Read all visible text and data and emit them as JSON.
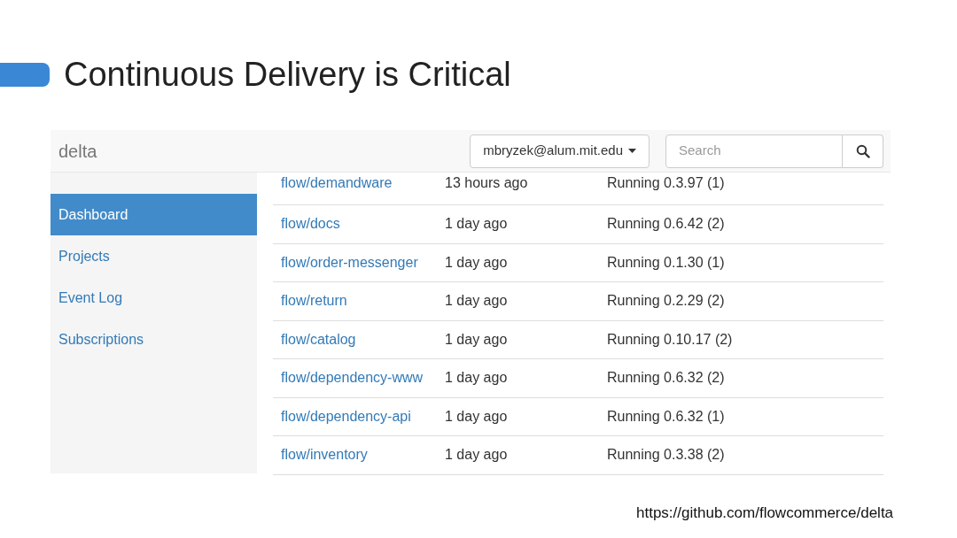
{
  "slide": {
    "title": "Continuous Delivery is Critical",
    "footer_url": "https://github.com/flowcommerce/delta"
  },
  "navbar": {
    "brand": "delta",
    "user_menu": "mbryzek@alum.mit.edu",
    "search": {
      "placeholder": "Search"
    }
  },
  "sidebar": {
    "items": [
      {
        "label": "Dashboard",
        "selected": true
      },
      {
        "label": "Projects",
        "selected": false
      },
      {
        "label": "Event Log",
        "selected": false
      },
      {
        "label": "Subscriptions",
        "selected": false
      }
    ]
  },
  "table": {
    "rows": [
      {
        "project": "flow/demandware",
        "time": "13 hours ago",
        "status": "Running 0.3.97 (1)"
      },
      {
        "project": "flow/docs",
        "time": "1 day ago",
        "status": "Running 0.6.42 (2)"
      },
      {
        "project": "flow/order-messenger",
        "time": "1 day ago",
        "status": "Running 0.1.30 (1)"
      },
      {
        "project": "flow/return",
        "time": "1 day ago",
        "status": "Running 0.2.29 (2)"
      },
      {
        "project": "flow/catalog",
        "time": "1 day ago",
        "status": "Running 0.10.17 (2)"
      },
      {
        "project": "flow/dependency-www",
        "time": "1 day ago",
        "status": "Running 0.6.32 (2)"
      },
      {
        "project": "flow/dependency-api",
        "time": "1 day ago",
        "status": "Running 0.6.32 (1)"
      },
      {
        "project": "flow/inventory",
        "time": "1 day ago",
        "status": "Running 0.3.38 (2)"
      }
    ]
  }
}
